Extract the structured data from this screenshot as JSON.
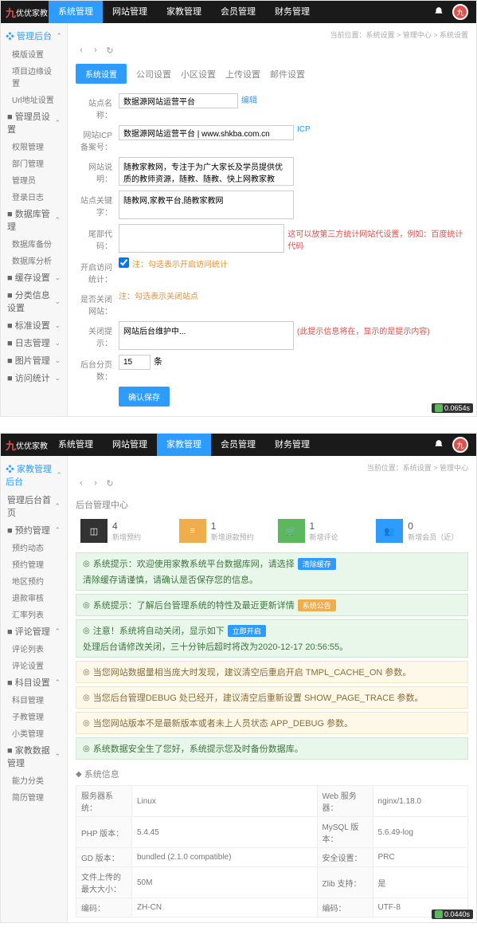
{
  "logo": {
    "red": "九",
    "text": "优优家教"
  },
  "nav": [
    "系统管理",
    "网站管理",
    "家教管理",
    "会员管理",
    "财务管理"
  ],
  "nav_active": [
    0,
    2
  ],
  "breadcrumb1": "当前位置：系统设置 > 管理中心 > 系统设置",
  "breadcrumb2": "当前位置：系统设置 > 管理中心",
  "sidebar1": {
    "header": "❖ 管理后台",
    "groups": [
      {
        "title": "",
        "items": [
          "模版设置",
          "项目边缘设置",
          "Url地址设置"
        ]
      },
      {
        "title": "■ 管理员设置",
        "items": [
          "权限管理",
          "部门管理",
          "管理员",
          "登录日志"
        ]
      },
      {
        "title": "■ 数据库管理",
        "items": [
          "数据库备份",
          "数据库分析"
        ]
      },
      {
        "title": "■ 缓存设置",
        "open": false
      },
      {
        "title": "■ 分类信息设置",
        "open": false
      },
      {
        "title": "■ 标准设置",
        "open": false
      },
      {
        "title": "■ 日志管理",
        "open": false
      },
      {
        "title": "■ 图片管理",
        "open": false
      },
      {
        "title": "■ 访问统计",
        "open": false
      }
    ]
  },
  "sidebar2": {
    "header": "❖ 家教管理后台",
    "groups": [
      {
        "title": "管理后台首页",
        "items": []
      },
      {
        "title": "■ 预约管理",
        "open": true,
        "items": [
          "预约动态",
          "预约管理",
          "地区预约",
          "退款审核",
          "汇率列表"
        ]
      },
      {
        "title": "■ 评论管理",
        "open": true,
        "items": [
          "评论列表",
          "评论设置"
        ]
      },
      {
        "title": "■ 科目设置",
        "open": true,
        "items": [
          "科目管理",
          "子教管理",
          "小类管理"
        ]
      },
      {
        "title": "■ 家教数据管理",
        "open": true,
        "items": [
          "能力分类",
          "简历管理"
        ]
      }
    ]
  },
  "toolbar_tabs": [
    "公司设置",
    "小区设置",
    "上传设置",
    "邮件设置"
  ],
  "form_btn": "系统设置",
  "form": {
    "site_name": {
      "label": "站点名称：",
      "value": "数据源网站运营平台",
      "link": "编辑"
    },
    "icp": {
      "label": "网站ICP备案号：",
      "value": "数据源网站运营平台 | www.shkba.com.cn",
      "link": "ICP"
    },
    "desc": {
      "label": "网站说明：",
      "value": "随教家教网，专注于为广大家长及学员提供优质的教师资源，随教、随教、快上网教家教网。"
    },
    "keywords": {
      "label": "站点关键字：",
      "value": "随教网,家教平台,随教家教网"
    },
    "code": {
      "label": "尾部代码：",
      "hint": "这可以放第三方统计网站代设置，例如：百度统计代码"
    },
    "stat": {
      "label": "开启访问统计：",
      "checkbox": true,
      "note": "注：勾选表示开启访问统计"
    },
    "close_reason": {
      "label": "是否关闭网站：",
      "note": "注：勾选表示关闭站点"
    },
    "close_tip": {
      "label": "关闭提示：",
      "value": "网站后台维护中...",
      "hint": "(此提示信息将在，显示的是提示内容)"
    },
    "page": {
      "label": "后台分页数：",
      "value": "15",
      "unit": "条"
    }
  },
  "save_btn": "确认保存",
  "timer1": "0.0654s",
  "panel2": {
    "title": "后台管理中心",
    "stats": [
      {
        "n": "4",
        "l": "新增预约"
      },
      {
        "n": "1",
        "l": "新增退款预约"
      },
      {
        "n": "1",
        "l": "新增评论"
      },
      {
        "n": "0",
        "l": "新增会员（近）"
      }
    ],
    "alerts": [
      {
        "type": "green",
        "text": "系统提示：欢迎使用家教系统平台数据库网，请选择",
        "chip": "清除缓存",
        "chip_cls": "",
        "tail": "清除缓存请谨慎，请确认是否保存您的信息。"
      },
      {
        "type": "green",
        "text": "系统提示：了解后台管理系统的特性及最近更新详情",
        "chip": "系统公告",
        "chip_cls": "orange"
      },
      {
        "type": "green",
        "text": "注意！系统将自动关闭，显示如下",
        "chip": "立即开启",
        "chip_cls": "",
        "tail": "处理后台请修改关闭，三十分钟后超时将改为2020-12-17 20:56:55。"
      },
      {
        "type": "yellow",
        "text": "当您网站数据量相当庞大时发现，建议清空后重启开启 TMPL_CACHE_ON 参数。"
      },
      {
        "type": "yellow",
        "text": "当您后台管理DEBUG 处已经开，建议清空后重新设置 SHOW_PAGE_TRACE 参数。"
      },
      {
        "type": "yellow",
        "text": "当您网站版本不是最新版本或者未上人员状态 APP_DEBUG 参数。"
      },
      {
        "type": "green",
        "text": "系统数据安全生了您好，系统提示您及时备份数据库。"
      }
    ],
    "sec_title": "系统信息",
    "info": [
      [
        "服务器系统：",
        "Linux",
        "Web 服务器：",
        "nginx/1.18.0"
      ],
      [
        "PHP 版本：",
        "5.4.45",
        "MySQL 版本：",
        "5.6.49-log"
      ],
      [
        "GD 版本：",
        "bundled (2.1.0 compatible)",
        "安全设置：",
        "PRC"
      ],
      [
        "文件上传的最大大小：",
        "50M",
        "Zlib 支持：",
        "是"
      ],
      [
        "编码：",
        "ZH-CN",
        "编码：",
        "UTF-8"
      ]
    ]
  },
  "timer2": "0.0440s"
}
